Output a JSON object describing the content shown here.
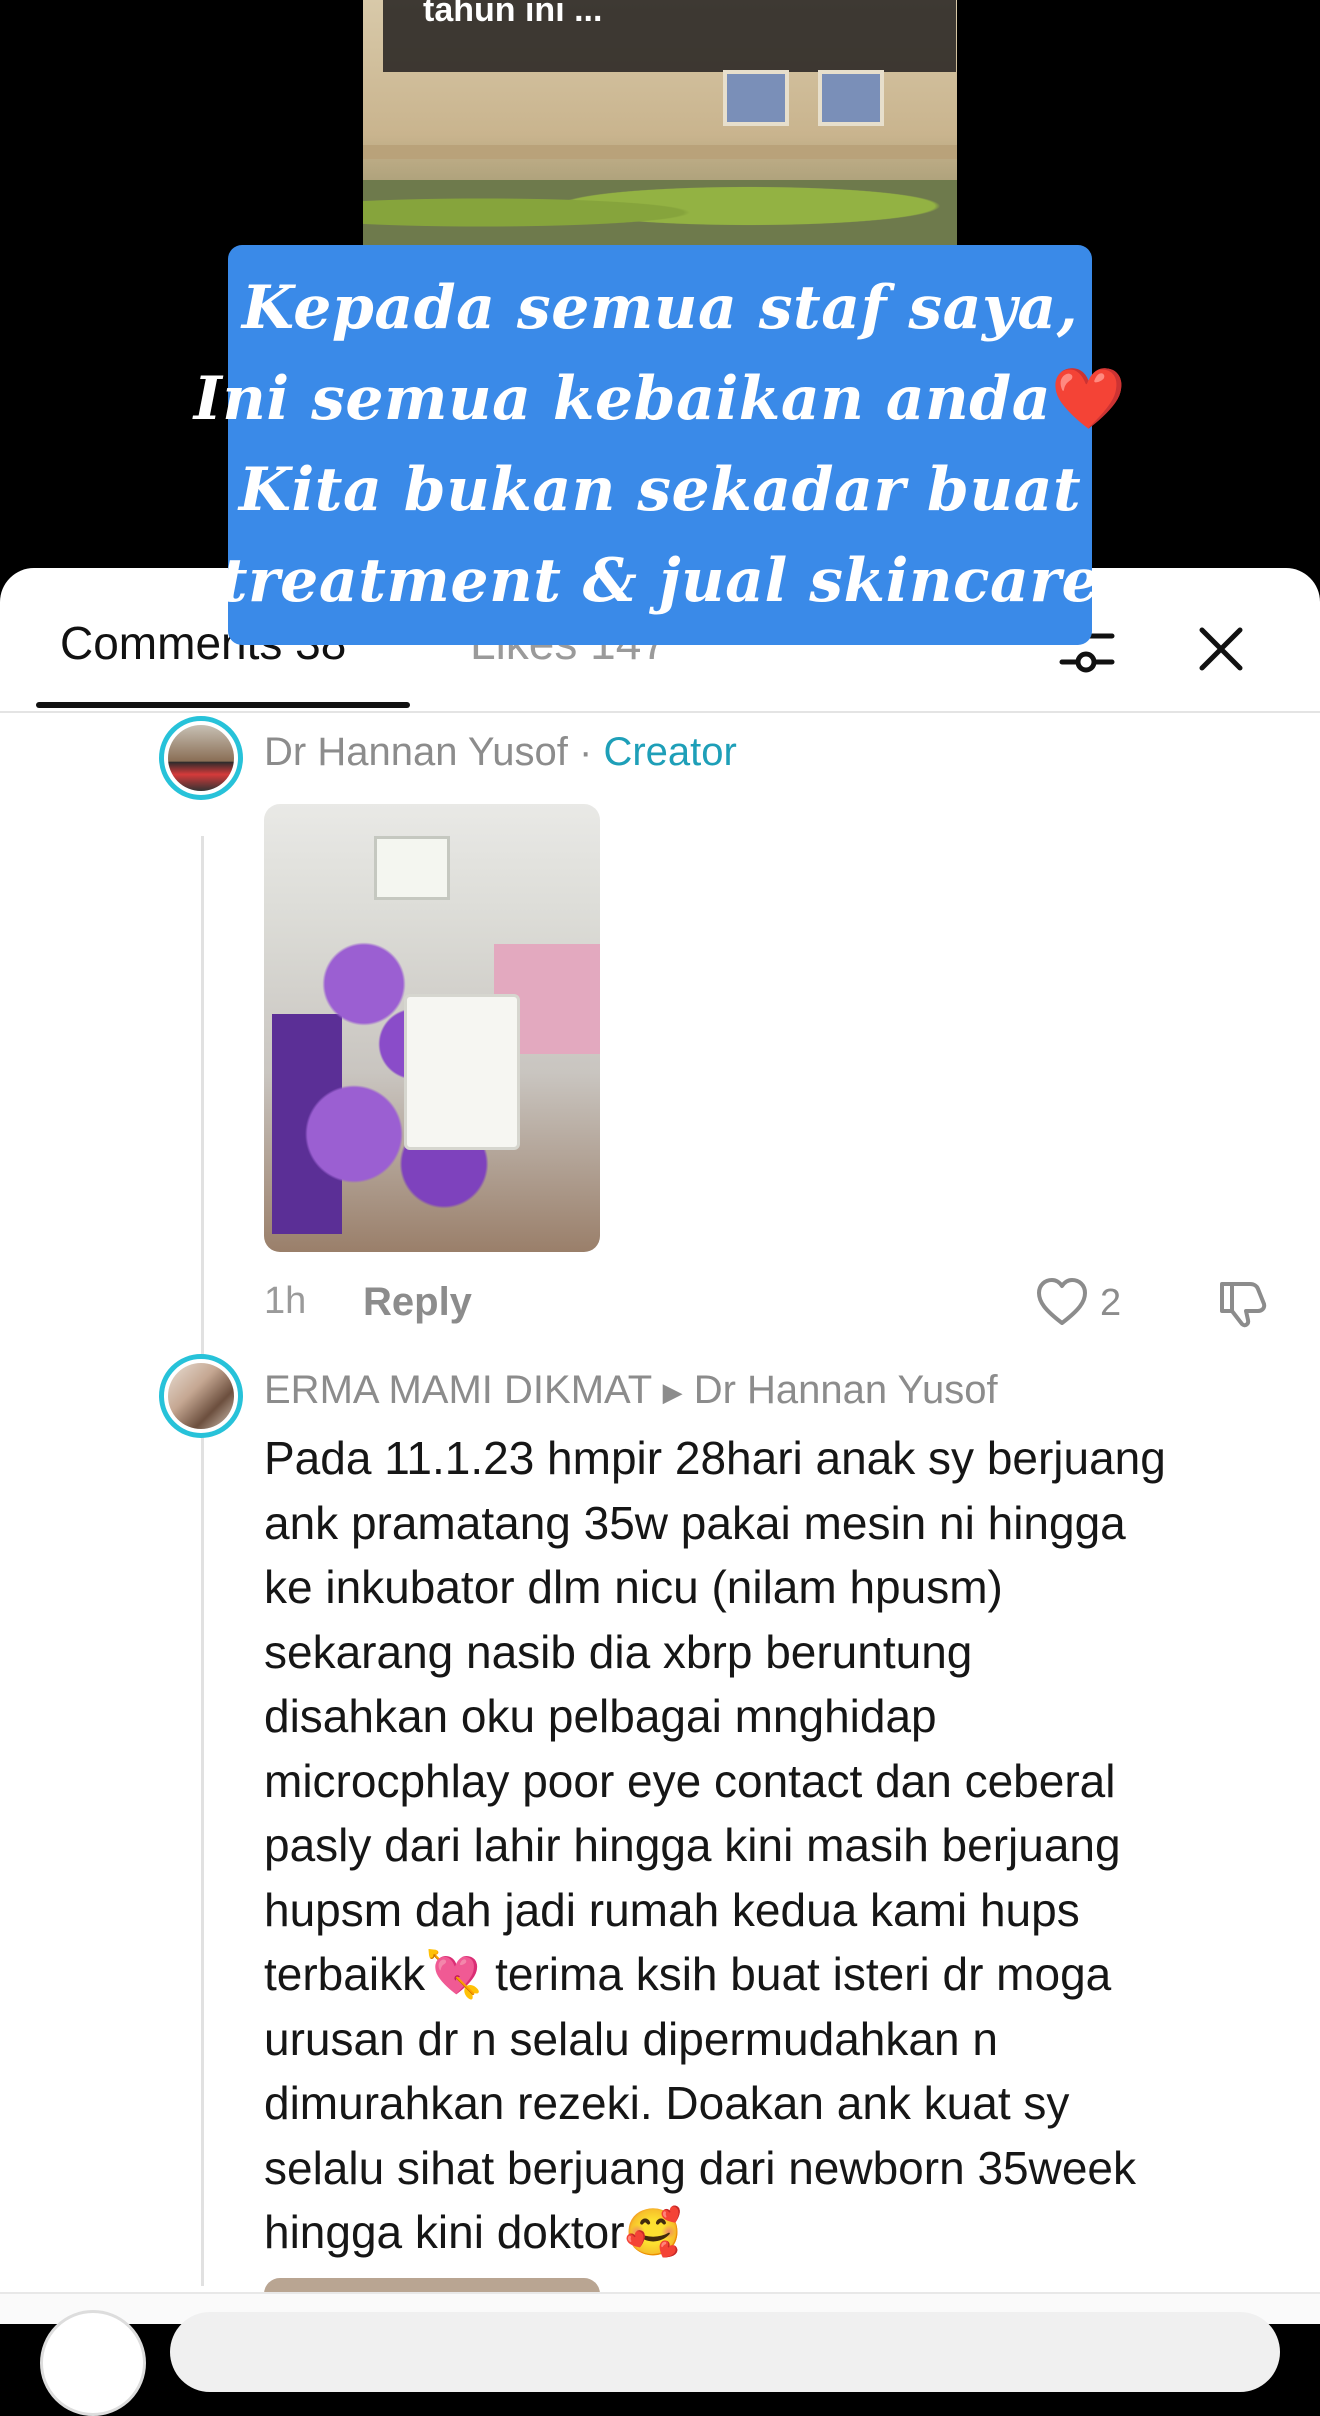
{
  "video": {
    "thumb_caption": "tahun ini ...",
    "overlay_lines": [
      "Kepada semua staf saya,",
      "Ini semua kebaikan anda",
      "Kita bukan sekadar buat",
      "treatment & jual skincare"
    ],
    "overlay_emoji": "❤️"
  },
  "tabs": {
    "comments": "Comments 38",
    "likes": "Likes 147"
  },
  "creator_comment": {
    "author": "Dr Hannan Yusof",
    "separator": " · ",
    "badge": "Creator",
    "time": "1h",
    "reply_label": "Reply",
    "likes": "2"
  },
  "reply_comment": {
    "author": "ERMA MAMI DIKMAT",
    "arrow": "▶",
    "reply_to": "Dr Hannan Yusof",
    "text": "Pada 11.1.23 hmpir 28hari anak sy berjuang\nank pramatang 35w pakai mesin ni hingga\nke inkubator dlm nicu (nilam hpusm)\nsekarang nasib dia xbrp beruntung\ndisahkan oku pelbagai mnghidap\nmicrocphlay poor eye contact dan ceberal\npasly dari lahir hingga kini masih berjuang\nhupsm dah jadi rumah kedua kami hups\nterbaikk💘 terima ksih buat isteri dr moga\nurusan dr n selalu dipermudahkan n\ndimurahkan rezeki. Doakan ank kuat sy\nselalu sihat berjuang dari newborn 35week\nhingga kini doktor🥰"
  },
  "colors": {
    "overlay_bg": "#3a8ae8",
    "creator_badge": "#1e9fb8",
    "avatar_ring": "#27c2d9"
  },
  "icons": [
    "filter-icon",
    "close-icon",
    "heart-icon",
    "dislike-icon"
  ]
}
